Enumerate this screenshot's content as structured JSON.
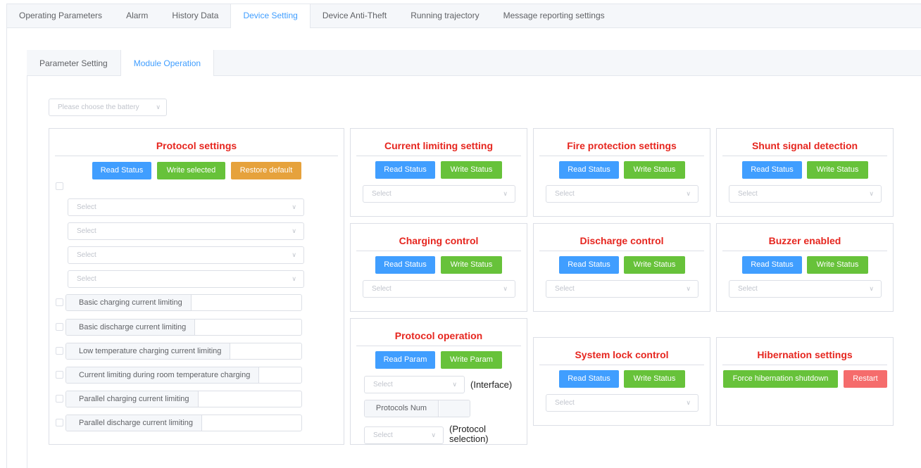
{
  "top_tabs": [
    "Operating Parameters",
    "Alarm",
    "History Data",
    "Device Setting",
    "Device Anti-Theft",
    "Running trajectory",
    "Message reporting settings"
  ],
  "sub_tabs": [
    "Parameter Setting",
    "Module Operation"
  ],
  "battery_placeholder": "Please choose the battery",
  "select_placeholder": "Select",
  "protocol_settings": {
    "title": "Protocol settings",
    "read": "Read Status",
    "write": "Write selected",
    "restore": "Restore default",
    "limits": [
      "Basic charging current limiting",
      "Basic discharge current limiting",
      "Low temperature charging current limiting",
      "Current limiting during room temperature charging",
      "Parallel charging current limiting",
      "Parallel discharge current limiting"
    ]
  },
  "common": {
    "read_status": "Read Status",
    "write_status": "Write Status"
  },
  "current_limiting": {
    "title": "Current limiting setting"
  },
  "fire_protection": {
    "title": "Fire protection settings"
  },
  "shunt_signal": {
    "title": "Shunt signal detection"
  },
  "charging_control": {
    "title": "Charging control"
  },
  "discharge_control": {
    "title": "Discharge control"
  },
  "buzzer": {
    "title": "Buzzer enabled"
  },
  "protocol_operation": {
    "title": "Protocol operation",
    "read": "Read Param",
    "write": "Write Param",
    "interface_label": "(Interface)",
    "protocols_num": "Protocols Num",
    "protocol_selection_line1": "(Protocol",
    "protocol_selection_line2": "selection)"
  },
  "system_lock": {
    "title": "System lock control"
  },
  "hibernation": {
    "title": "Hibernation settings",
    "force": "Force hibernation shutdown",
    "restart": "Restart"
  },
  "colors": {
    "accent": "#409eff",
    "title_red": "#e6261f",
    "green": "#67c23a",
    "orange": "#e6a23c",
    "red": "#f56c6c"
  }
}
